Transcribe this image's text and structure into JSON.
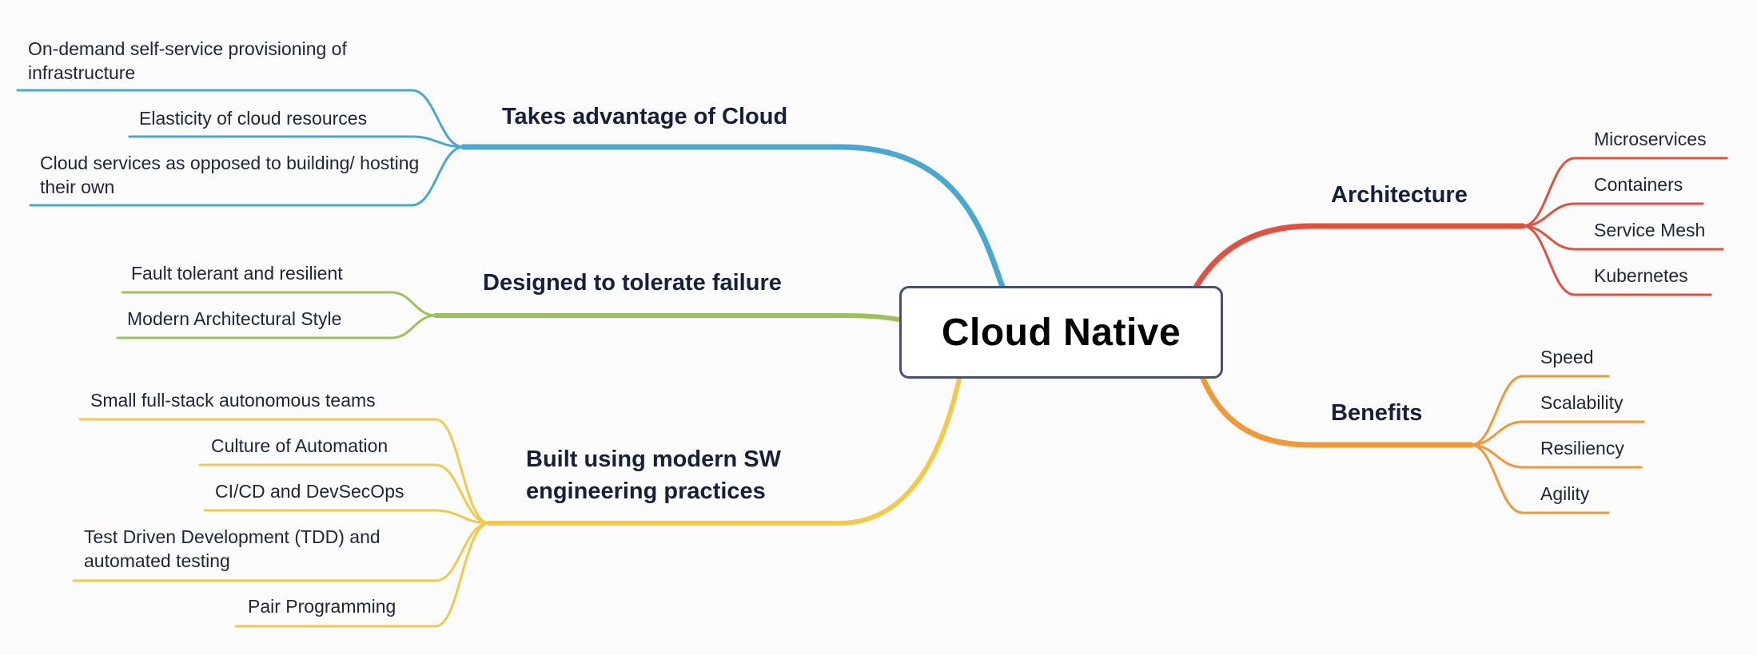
{
  "root": {
    "label": "Cloud Native",
    "border_color": "#44507a"
  },
  "branches": [
    {
      "id": "cloud",
      "label": "Takes advantage of Cloud",
      "color": "#4aa8cf",
      "side": "left",
      "children": [
        "On-demand self-service provisioning of infrastructure",
        "Elasticity of cloud resources",
        "Cloud services as opposed to building/ hosting their own"
      ]
    },
    {
      "id": "failure",
      "label": "Designed to tolerate failure",
      "color": "#9dc15a",
      "side": "left",
      "children": [
        "Fault tolerant and resilient",
        "Modern Architectural Style"
      ]
    },
    {
      "id": "practices",
      "label": "Built using modern SW engineering practices",
      "color": "#f2c94c",
      "side": "left",
      "children": [
        "Small full-stack autonomous teams",
        "Culture of Automation",
        "CI/CD and DevSecOps",
        "Test Driven Development (TDD) and automated testing",
        "Pair Programming"
      ]
    },
    {
      "id": "architecture",
      "label": "Architecture",
      "color": "#e05140",
      "side": "right",
      "children": [
        "Microservices",
        "Containers",
        "Service Mesh",
        "Kubernetes"
      ]
    },
    {
      "id": "benefits",
      "label": "Benefits",
      "color": "#ee9a3a",
      "side": "right",
      "children": [
        "Speed",
        "Scalability",
        "Resiliency",
        "Agility"
      ]
    }
  ]
}
